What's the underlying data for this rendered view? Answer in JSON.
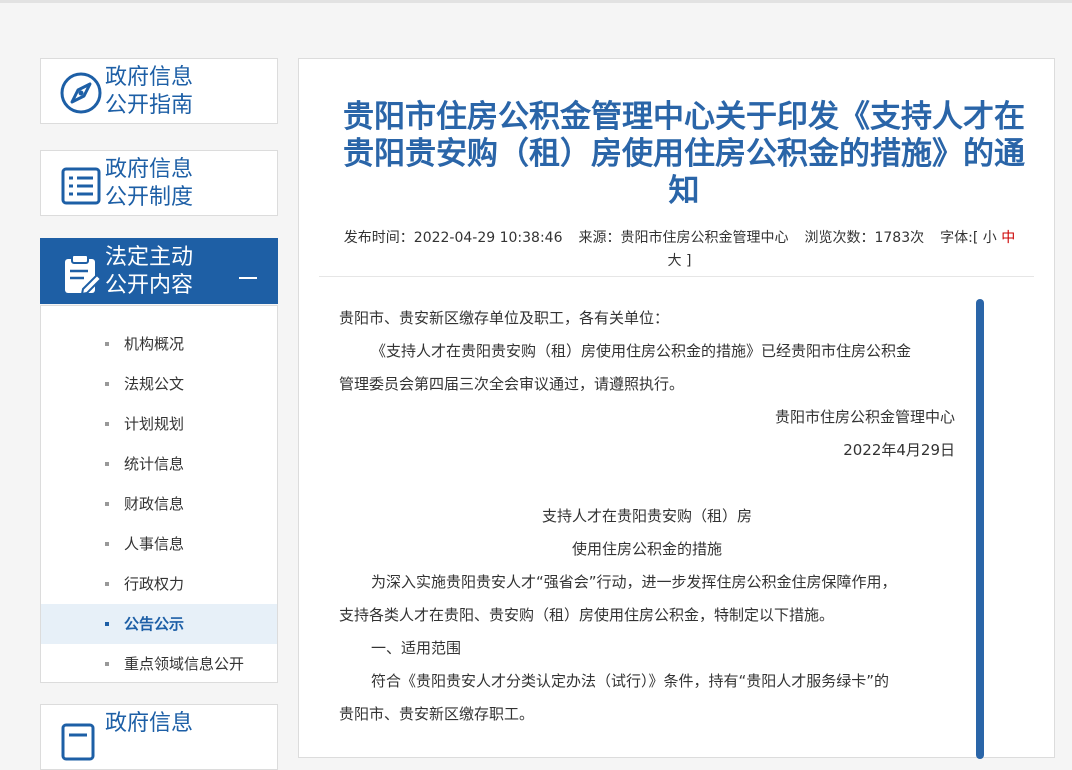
{
  "sidebar": {
    "cards": [
      {
        "title_line1": "政府信息",
        "title_line2": "公开指南"
      },
      {
        "title_line1": "政府信息",
        "title_line2": "公开制度"
      },
      {
        "title_line1": "法定主动",
        "title_line2": "公开内容"
      },
      {
        "title_line1": "政府信息",
        "title_line2": ""
      }
    ],
    "items": [
      {
        "label": "机构概况"
      },
      {
        "label": "法规公文"
      },
      {
        "label": "计划规划"
      },
      {
        "label": "统计信息"
      },
      {
        "label": "财政信息"
      },
      {
        "label": "人事信息"
      },
      {
        "label": "行政权力"
      },
      {
        "label": "公告公示"
      },
      {
        "label": "重点领域信息公开"
      }
    ]
  },
  "article": {
    "title_line1": "贵阳市住房公积金管理中心关于印发《支持人才在",
    "title_line2": "贵阳贵安购（租）房使用住房公积金的措施》的通",
    "title_line3": "知",
    "meta": {
      "publish_label": "发布时间：",
      "publish_time": "2022-04-29 10:38:46",
      "source_label": "来源：",
      "source": "贵阳市住房公积金管理中心",
      "views_label": "浏览次数：",
      "views": "1783次",
      "font_label": "字体:[",
      "font_small": "小",
      "font_medium": "中",
      "font_large": "大",
      "font_close": "]"
    },
    "body": {
      "salutation": "贵阳市、贵安新区缴存单位及职工，各有关单位：",
      "intro_line1": "《支持人才在贵阳贵安购（租）房使用住房公积金的措施》已经贵阳市住房公积金",
      "intro_line2": "管理委员会第四届三次全会审议通过，请遵照执行。",
      "signature": "贵阳市住房公积金管理中心",
      "date": "2022年4月29日",
      "doc_title_line1": "支持人才在贵阳贵安购（租）房",
      "doc_title_line2": "使用住房公积金的措施",
      "p1_line1": "为深入实施贵阳贵安人才“强省会”行动，进一步发挥住房公积金住房保障作用，",
      "p1_line2": "支持各类人才在贵阳、贵安购（租）房使用住房公积金，特制定以下措施。",
      "section1": "一、适用范围",
      "p2_line1": "符合《贵阳贵安人才分类认定办法（试行）》条件，持有“贵阳人才服务绿卡”的",
      "p2_line2": "贵阳市、贵安新区缴存职工。"
    }
  },
  "colors": {
    "brand_blue": "#1e5fa5",
    "title_blue": "#2a65a8",
    "active_bg": "#e7f0f8",
    "highlight_red": "#cc0000"
  }
}
